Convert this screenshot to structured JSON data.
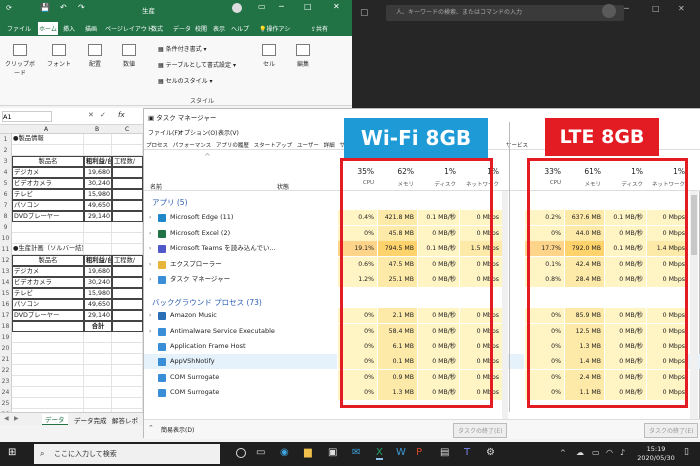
{
  "excel": {
    "title": "生産",
    "search": "操作アシ",
    "share": "共有",
    "tabs": [
      "ファイル",
      "ホーム",
      "挿入",
      "描画",
      "ページレイアウト",
      "数式",
      "データ",
      "校閲",
      "表示",
      "ヘルプ"
    ],
    "groups": {
      "clipboard": "クリップボード",
      "font": "フォント",
      "align": "配置",
      "number": "数値",
      "cond": "条件付き書式",
      "table": "テーブルとして書式設定",
      "style": "セルのスタイル",
      "style_group": "スタイル",
      "cells": "セル",
      "edit": "編集"
    },
    "name_box": "A1",
    "fx": "fx",
    "cols": [
      "A",
      "B",
      "C"
    ],
    "rows": [
      {
        "n": "1",
        "a": "●製品情報",
        "b": "",
        "c": ""
      },
      {
        "n": "2",
        "a": "",
        "b": "",
        "c": ""
      },
      {
        "n": "3",
        "a": "製品名",
        "b": "粗利益/台",
        "c": "工程数/",
        "box": true,
        "hdr": true
      },
      {
        "n": "4",
        "a": "デジカメ",
        "b": "19,680",
        "c": "",
        "box": true
      },
      {
        "n": "5",
        "a": "ビデオカメラ",
        "b": "30,240",
        "c": "",
        "box": true
      },
      {
        "n": "6",
        "a": "テレビ",
        "b": "15,980",
        "c": "",
        "box": true
      },
      {
        "n": "7",
        "a": "パソコン",
        "b": "49,650",
        "c": "",
        "box": true
      },
      {
        "n": "8",
        "a": "DVDプレーヤー",
        "b": "29,140",
        "c": "",
        "box": true
      },
      {
        "n": "9",
        "a": "",
        "b": "",
        "c": ""
      },
      {
        "n": "10",
        "a": "",
        "b": "",
        "c": ""
      },
      {
        "n": "11",
        "a": "●生産計画（ソルバー結果）",
        "b": "",
        "c": ""
      },
      {
        "n": "12",
        "a": "製品名",
        "b": "粗利益/台",
        "c": "工程数/",
        "box": true,
        "hdr": true
      },
      {
        "n": "13",
        "a": "デジカメ",
        "b": "19,680",
        "c": "",
        "box": true
      },
      {
        "n": "14",
        "a": "ビデオカメラ",
        "b": "30,240",
        "c": "",
        "box": true
      },
      {
        "n": "15",
        "a": "テレビ",
        "b": "15,980",
        "c": "",
        "box": true
      },
      {
        "n": "16",
        "a": "パソコン",
        "b": "49,650",
        "c": "",
        "box": true
      },
      {
        "n": "17",
        "a": "DVDプレーヤー",
        "b": "29,140",
        "c": "",
        "box": true
      },
      {
        "n": "18",
        "a": "",
        "b": "合計",
        "c": "",
        "box": true
      },
      {
        "n": "19",
        "a": "",
        "b": "",
        "c": ""
      },
      {
        "n": "20",
        "a": "",
        "b": "",
        "c": ""
      },
      {
        "n": "21",
        "a": "",
        "b": "",
        "c": ""
      },
      {
        "n": "22",
        "a": "",
        "b": "",
        "c": ""
      },
      {
        "n": "23",
        "a": "",
        "b": "",
        "c": ""
      },
      {
        "n": "24",
        "a": "",
        "b": "",
        "c": ""
      },
      {
        "n": "25",
        "a": "",
        "b": "",
        "c": ""
      },
      {
        "n": "26",
        "a": "",
        "b": "",
        "c": ""
      }
    ],
    "sheets": [
      "データ",
      "データ完成",
      "解答レポ"
    ]
  },
  "dark_search": "人、キーワードの検索、またはコマンドの入力",
  "tm": {
    "title": "タスク マネージャー",
    "menu": [
      "ファイル(F)",
      "オプション(O)",
      "表示(V)"
    ],
    "tabs": [
      "プロセス",
      "パフォーマンス",
      "アプリの履歴",
      "スタートアップ",
      "ユーザー",
      "詳細",
      "サービス"
    ],
    "tab_right": "サービス",
    "col_name": "名前",
    "col_status": "状態",
    "left": {
      "cpu": "35%",
      "mem": "62%",
      "disk": "1%",
      "net": "1%"
    },
    "right": {
      "cpu": "33%",
      "mem": "61%",
      "disk": "1%",
      "net": "1%"
    },
    "labels": {
      "cpu": "CPU",
      "mem": "メモリ",
      "disk": "ディスク",
      "net": "ネットワーク"
    },
    "apps_group": "アプリ (5)",
    "bg_group": "バックグラウンド プロセス (73)",
    "rows": [
      {
        "name": "Microsoft Edge (11)",
        "color": "#1e88c9",
        "exp": true,
        "l": [
          "0.4%",
          "421.8 MB",
          "0.1 MB/秒",
          "0 Mbps"
        ],
        "r": [
          "0.2%",
          "637.6 MB",
          "0.1 MB/秒",
          "0 Mbps"
        ],
        "hot": false
      },
      {
        "name": "Microsoft Excel (2)",
        "color": "#217346",
        "exp": true,
        "l": [
          "0%",
          "45.8 MB",
          "0 MB/秒",
          "0 Mbps"
        ],
        "r": [
          "0%",
          "44.0 MB",
          "0 MB/秒",
          "0 Mbps"
        ],
        "hot": false
      },
      {
        "name": "Microsoft Teams を読み込んでい...",
        "color": "#5059c9",
        "exp": true,
        "l": [
          "19.1%",
          "794.5 MB",
          "0.1 MB/秒",
          "1.5 Mbps"
        ],
        "r": [
          "17.7%",
          "792.0 MB",
          "0.1 MB/秒",
          "1.4 Mbps"
        ],
        "hot": true
      },
      {
        "name": "エクスプローラー",
        "color": "#e8b53a",
        "exp": true,
        "l": [
          "0.6%",
          "47.5 MB",
          "0 MB/秒",
          "0 Mbps"
        ],
        "r": [
          "0.1%",
          "42.4 MB",
          "0 MB/秒",
          "0 Mbps"
        ],
        "hot": false
      },
      {
        "name": "タスク マネージャー",
        "color": "#3a8ed8",
        "exp": true,
        "l": [
          "1.2%",
          "25.1 MB",
          "0 MB/秒",
          "0 Mbps"
        ],
        "r": [
          "0.8%",
          "28.4 MB",
          "0 MB/秒",
          "0 Mbps"
        ],
        "hot": false
      },
      {
        "name": "Amazon Music",
        "color": "#2a6fb5",
        "exp": true,
        "l": [
          "0%",
          "2.1 MB",
          "0 MB/秒",
          "0 Mbps"
        ],
        "r": [
          "0%",
          "85.9 MB",
          "0 MB/秒",
          "0 Mbps"
        ],
        "hot": false
      },
      {
        "name": "Antimalware Service Executable",
        "color": "#3a8ed8",
        "exp": true,
        "l": [
          "0%",
          "58.4 MB",
          "0 MB/秒",
          "0 Mbps"
        ],
        "r": [
          "0%",
          "12.5 MB",
          "0 MB/秒",
          "0 Mbps"
        ],
        "hot": false
      },
      {
        "name": "Application Frame Host",
        "color": "#3a8ed8",
        "exp": false,
        "l": [
          "0%",
          "6.1 MB",
          "0 MB/秒",
          "0 Mbps"
        ],
        "r": [
          "0%",
          "1.3 MB",
          "0 MB/秒",
          "0 Mbps"
        ],
        "hot": false
      },
      {
        "name": "AppVShNotify",
        "color": "#3a8ed8",
        "exp": false,
        "l": [
          "0%",
          "0.1 MB",
          "0 MB/秒",
          "0 Mbps"
        ],
        "r": [
          "0%",
          "1.4 MB",
          "0 MB/秒",
          "0 Mbps"
        ],
        "hot": false
      },
      {
        "name": "COM Surrogate",
        "color": "#3a8ed8",
        "exp": false,
        "l": [
          "0%",
          "0.9 MB",
          "0 MB/秒",
          "0 Mbps"
        ],
        "r": [
          "0%",
          "2.4 MB",
          "0 MB/秒",
          "0 Mbps"
        ],
        "hot": false
      },
      {
        "name": "COM Surrogate",
        "color": "#3a8ed8",
        "exp": false,
        "l": [
          "0%",
          "1.3 MB",
          "0 MB/秒",
          "0 Mbps"
        ],
        "r": [
          "0%",
          "1.1 MB",
          "0 MB/秒",
          "0 Mbps"
        ],
        "hot": false
      }
    ],
    "fewer": "簡易表示(D)",
    "end_task": "タスクの終了(E)"
  },
  "badges": {
    "wifi": "Wi-Fi 8GB",
    "lte": "LTE 8GB"
  },
  "taskbar": {
    "search": "ここに入力して検索",
    "time": "15:19",
    "date": "2020/05/30"
  },
  "colors": {
    "red": "#e31b23",
    "blue_badge": "#1e9ad6",
    "excel": "#217346"
  }
}
